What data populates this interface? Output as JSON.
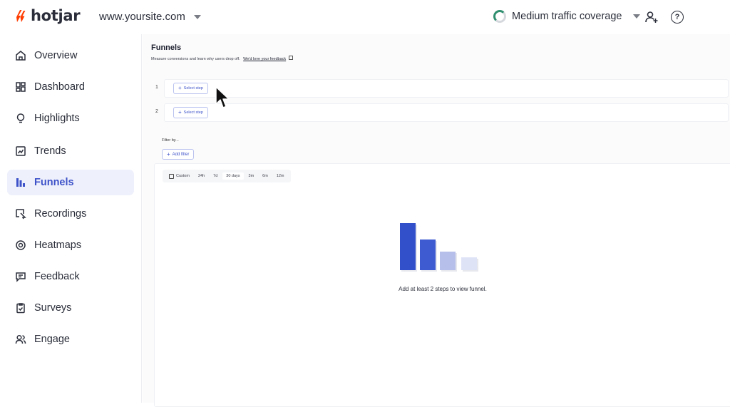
{
  "header": {
    "logo_text": "hotjar",
    "site_name": "www.yoursite.com",
    "coverage_label": "Medium traffic coverage",
    "coverage_icon": "progress-ring-icon",
    "invite_icon": "add-user-icon",
    "help_icon": "help-icon",
    "brand_color": "#ff3c00"
  },
  "sidebar": {
    "items": [
      {
        "label": "Overview",
        "icon": "home-icon"
      },
      {
        "label": "Dashboard",
        "icon": "dashboard-icon"
      },
      {
        "label": "Highlights",
        "icon": "lightbulb-icon"
      },
      {
        "label": "Trends",
        "icon": "trend-chart-icon"
      },
      {
        "label": "Funnels",
        "icon": "funnel-bars-icon",
        "active": true
      },
      {
        "label": "Recordings",
        "icon": "recording-icon"
      },
      {
        "label": "Heatmaps",
        "icon": "heatmap-icon"
      },
      {
        "label": "Feedback",
        "icon": "feedback-icon"
      },
      {
        "label": "Surveys",
        "icon": "survey-icon"
      },
      {
        "label": "Engage",
        "icon": "users-icon"
      }
    ],
    "active_color": "#3d52c9"
  },
  "main": {
    "title": "Funnels",
    "subtitle": "Measure conversions and learn why users drop off.",
    "feedback_link": "We'd love your feedback",
    "steps": [
      {
        "number": "1",
        "button_label": "Select step"
      },
      {
        "number": "2",
        "button_label": "Select step"
      }
    ],
    "filter_label": "Filter by...",
    "add_filter_label": "Add filter",
    "date_options": [
      "Custom",
      "24h",
      "7d",
      "30 days",
      "3m",
      "6m",
      "12m"
    ],
    "empty_message": "Add at least 2 steps to view funnel.",
    "illustration_colors": [
      "#3150c9",
      "#3f5bd1",
      "#b6bfe9",
      "#dfe3f6"
    ]
  }
}
